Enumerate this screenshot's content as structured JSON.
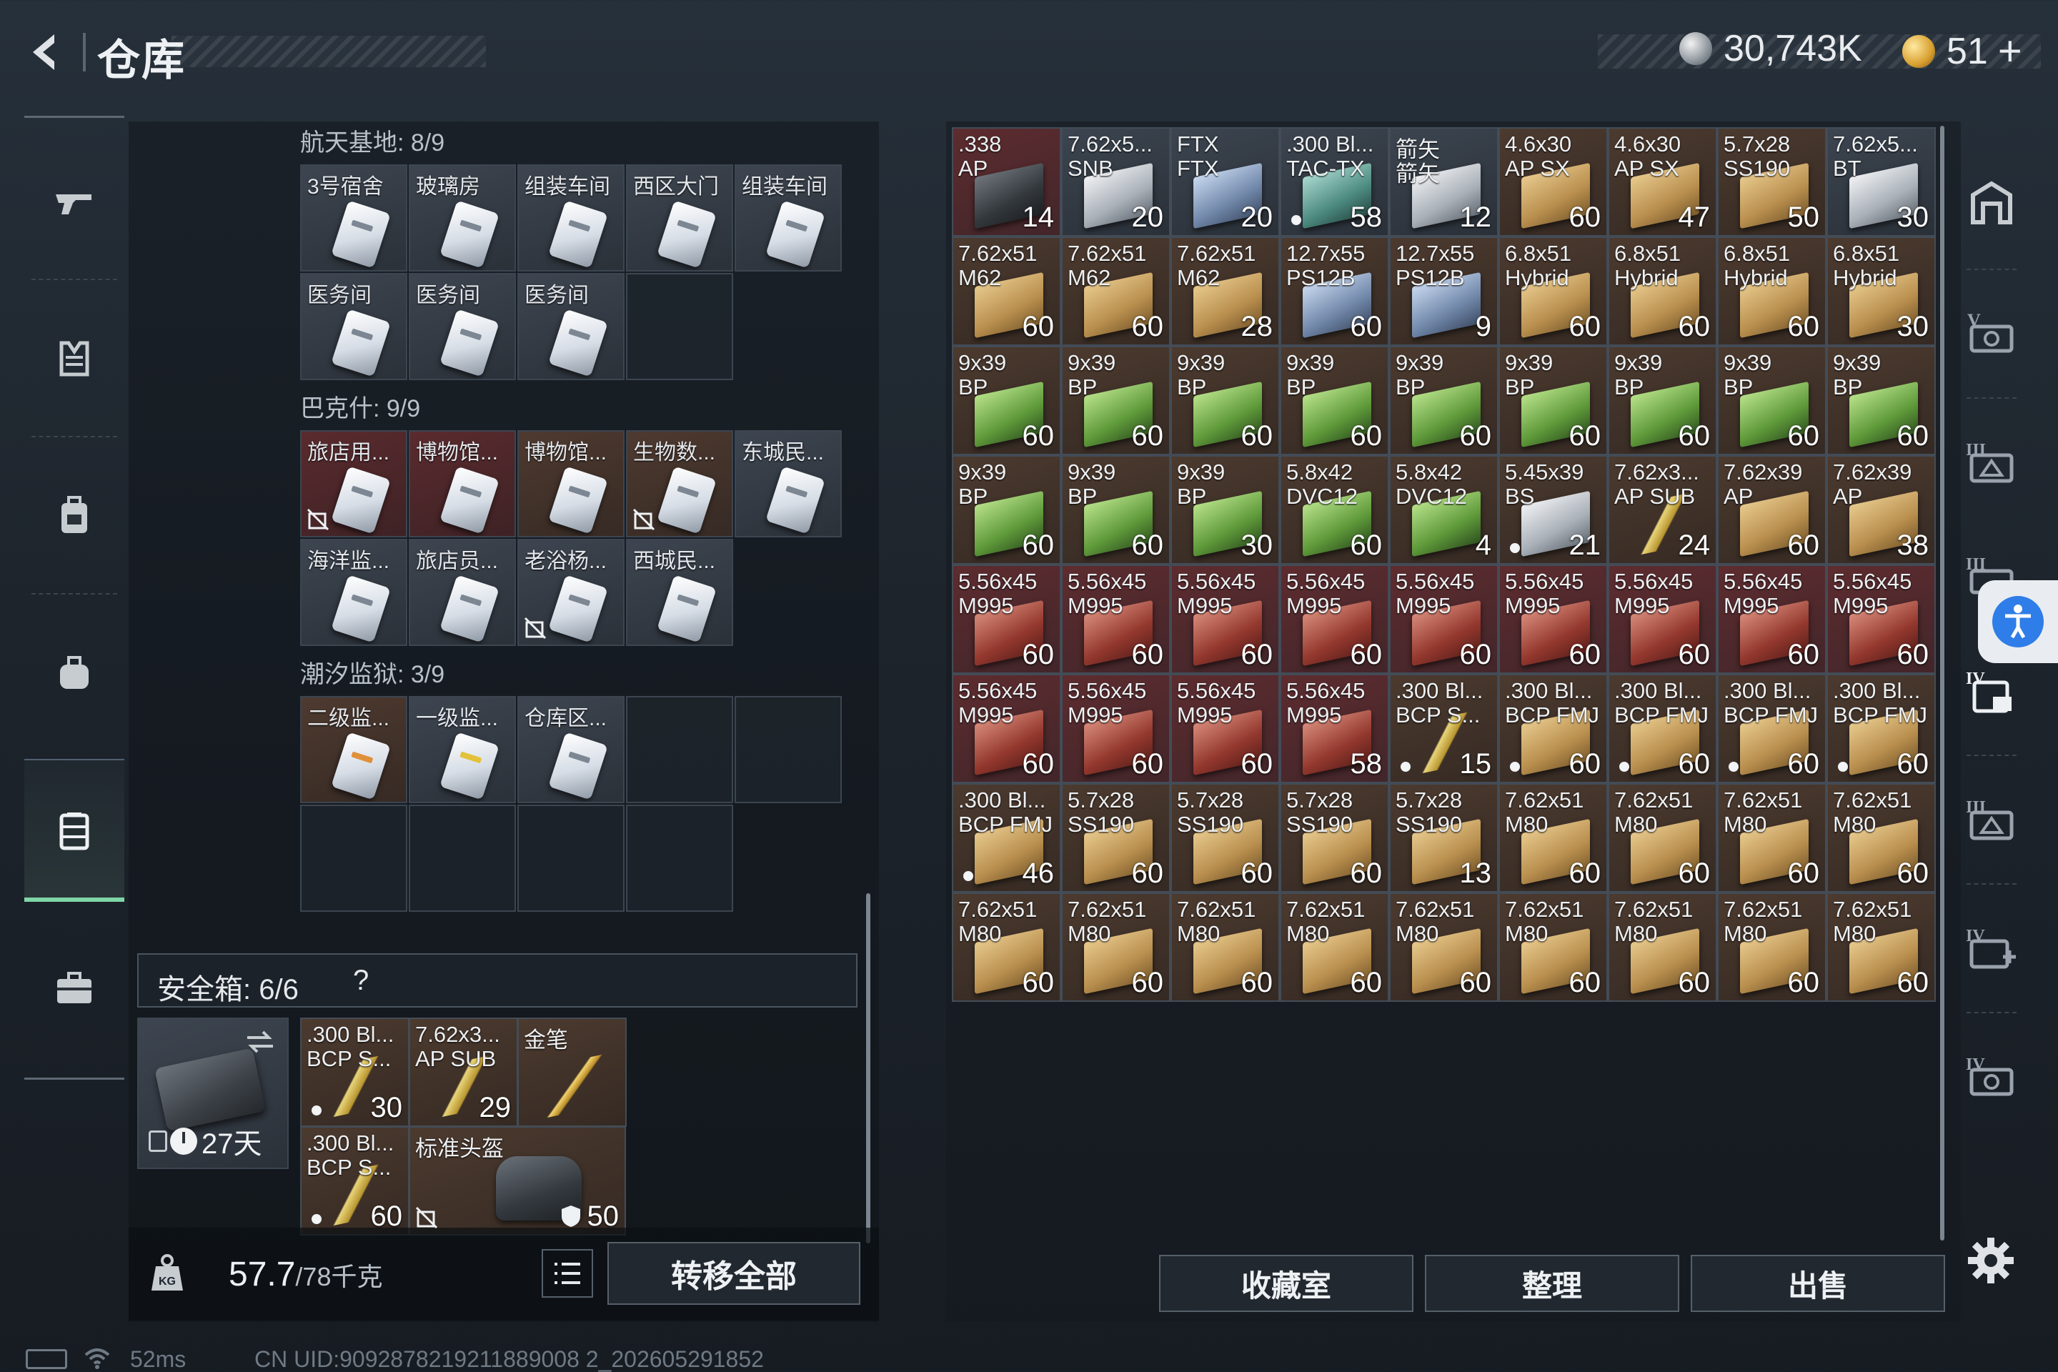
{
  "header": {
    "title": "仓库",
    "currency_silver": "30,743K",
    "currency_gold": "51",
    "plus_label": "+"
  },
  "left_nav": {
    "items": [
      "gun-icon",
      "armor-icon",
      "backpack-icon",
      "bag-icon",
      "stash-icon",
      "briefcase-icon"
    ],
    "active": "stash-icon"
  },
  "key_sections": [
    {
      "label": "航天基地: 8/9",
      "cells": [
        {
          "name": "3号宿舍",
          "bg": "grey"
        },
        {
          "name": "玻璃房",
          "bg": "grey"
        },
        {
          "name": "组装车间",
          "bg": "grey"
        },
        {
          "name": "西区大门",
          "bg": "grey"
        },
        {
          "name": "组装车间",
          "bg": "grey"
        },
        {
          "name": "医务间",
          "bg": "grey"
        },
        {
          "name": "医务间",
          "bg": "grey"
        },
        {
          "name": "医务间",
          "bg": "grey"
        },
        {
          "name": "",
          "bg": "empty"
        }
      ]
    },
    {
      "label": "巴克什: 9/9",
      "cells": [
        {
          "name": "旅店用...",
          "bg": "red",
          "no_trade": true
        },
        {
          "name": "博物馆...",
          "bg": "red"
        },
        {
          "name": "博物馆...",
          "bg": "brown"
        },
        {
          "name": "生物数...",
          "bg": "brown",
          "no_trade": true
        },
        {
          "name": "东城民...",
          "bg": "grey"
        },
        {
          "name": "海洋监...",
          "bg": "grey"
        },
        {
          "name": "旅店员...",
          "bg": "grey"
        },
        {
          "name": "老浴杨...",
          "bg": "grey",
          "no_trade": true
        },
        {
          "name": "西城民...",
          "bg": "grey"
        }
      ]
    },
    {
      "label": "潮汐监狱: 3/9",
      "cells": [
        {
          "name": "二级监...",
          "bg": "brown",
          "card": "orange"
        },
        {
          "name": "一级监...",
          "bg": "grey",
          "card": "yellow"
        },
        {
          "name": "仓库区...",
          "bg": "grey"
        },
        {
          "name": "",
          "bg": "empty"
        },
        {
          "name": "",
          "bg": "empty"
        },
        {
          "name": "",
          "bg": "empty"
        },
        {
          "name": "",
          "bg": "empty"
        },
        {
          "name": "",
          "bg": "empty"
        },
        {
          "name": "",
          "bg": "empty"
        }
      ]
    }
  ],
  "safe_box": {
    "title": "安全箱: 6/6",
    "help": "?",
    "timer": "27天",
    "items": [
      {
        "n1": ".300 Bl...",
        "n2": "BCP S...",
        "count": "30",
        "dot": true,
        "art": "cartridge",
        "bg": "brown"
      },
      {
        "n1": "7.62x3...",
        "n2": "AP SUB",
        "count": "29",
        "art": "cartridge",
        "bg": "brown"
      },
      {
        "n1": "金笔",
        "n2": "",
        "count": "",
        "art": "pen",
        "bg": "brown"
      },
      {
        "n1": ".300 Bl...",
        "n2": "BCP S...",
        "count": "60",
        "dot": true,
        "art": "cartridge",
        "bg": "brown",
        "no_trade": true
      },
      {
        "n1": "标准头盔",
        "n2": "",
        "count": "50",
        "art": "bag",
        "bg": "brown",
        "no_trade": true,
        "shield": true
      }
    ]
  },
  "weight": {
    "current": "57.7",
    "total": "/78千克",
    "transfer_label": "转移全部"
  },
  "stash": {
    "cells": [
      {
        "n1": ".338",
        "n2": "AP",
        "count": "14",
        "bg": "red",
        "art": "dark"
      },
      {
        "n1": "7.62x5...",
        "n2": "SNB",
        "count": "20",
        "bg": "grey",
        "art": "silver"
      },
      {
        "n1": "FTX",
        "n2": "FTX",
        "count": "20",
        "bg": "grey",
        "art": "blue"
      },
      {
        "n1": ".300 Bl...",
        "n2": "TAC-TX",
        "count": "58",
        "bg": "grey",
        "art": "teal",
        "dot": true
      },
      {
        "n1": "箭矢",
        "n2": "箭矢",
        "count": "12",
        "bg": "grey",
        "art": "silver"
      },
      {
        "n1": "4.6x30",
        "n2": "AP SX",
        "count": "60",
        "bg": "brown",
        "art": "box"
      },
      {
        "n1": "4.6x30",
        "n2": "AP SX",
        "count": "47",
        "bg": "brown",
        "art": "box"
      },
      {
        "n1": "5.7x28",
        "n2": "SS190",
        "count": "50",
        "bg": "brown",
        "art": "box"
      },
      {
        "n1": "7.62x5...",
        "n2": "BT",
        "count": "30",
        "bg": "grey",
        "art": "silver"
      },
      {
        "n1": "7.62x51",
        "n2": "M62",
        "count": "60",
        "bg": "brown",
        "art": "box"
      },
      {
        "n1": "7.62x51",
        "n2": "M62",
        "count": "60",
        "bg": "brown",
        "art": "box"
      },
      {
        "n1": "7.62x51",
        "n2": "M62",
        "count": "28",
        "bg": "brown",
        "art": "box"
      },
      {
        "n1": "12.7x55",
        "n2": "PS12B",
        "count": "60",
        "bg": "brown",
        "art": "blue"
      },
      {
        "n1": "12.7x55",
        "n2": "PS12B",
        "count": "9",
        "bg": "brown",
        "art": "blue"
      },
      {
        "n1": "6.8x51",
        "n2": "Hybrid",
        "count": "60",
        "bg": "brown",
        "art": "box"
      },
      {
        "n1": "6.8x51",
        "n2": "Hybrid",
        "count": "60",
        "bg": "brown",
        "art": "box"
      },
      {
        "n1": "6.8x51",
        "n2": "Hybrid",
        "count": "60",
        "bg": "brown",
        "art": "box"
      },
      {
        "n1": "6.8x51",
        "n2": "Hybrid",
        "count": "30",
        "bg": "brown",
        "art": "box"
      },
      {
        "n1": "9x39",
        "n2": "BP",
        "count": "60",
        "bg": "brown",
        "art": "green"
      },
      {
        "n1": "9x39",
        "n2": "BP",
        "count": "60",
        "bg": "brown",
        "art": "green"
      },
      {
        "n1": "9x39",
        "n2": "BP",
        "count": "60",
        "bg": "brown",
        "art": "green"
      },
      {
        "n1": "9x39",
        "n2": "BP",
        "count": "60",
        "bg": "brown",
        "art": "green"
      },
      {
        "n1": "9x39",
        "n2": "BP",
        "count": "60",
        "bg": "brown",
        "art": "green"
      },
      {
        "n1": "9x39",
        "n2": "BP",
        "count": "60",
        "bg": "brown",
        "art": "green"
      },
      {
        "n1": "9x39",
        "n2": "BP",
        "count": "60",
        "bg": "brown",
        "art": "green"
      },
      {
        "n1": "9x39",
        "n2": "BP",
        "count": "60",
        "bg": "brown",
        "art": "green"
      },
      {
        "n1": "9x39",
        "n2": "BP",
        "count": "60",
        "bg": "brown",
        "art": "green"
      },
      {
        "n1": "9x39",
        "n2": "BP",
        "count": "60",
        "bg": "brown",
        "art": "green"
      },
      {
        "n1": "9x39",
        "n2": "BP",
        "count": "60",
        "bg": "brown",
        "art": "green"
      },
      {
        "n1": "9x39",
        "n2": "BP",
        "count": "30",
        "bg": "brown",
        "art": "green"
      },
      {
        "n1": "5.8x42",
        "n2": "DVC12",
        "count": "60",
        "bg": "brown",
        "art": "green"
      },
      {
        "n1": "5.8x42",
        "n2": "DVC12",
        "count": "4",
        "bg": "brown",
        "art": "green"
      },
      {
        "n1": "5.45x39",
        "n2": "BS",
        "count": "21",
        "bg": "brown",
        "art": "silver",
        "dot": true
      },
      {
        "n1": "7.62x3...",
        "n2": "AP SUB",
        "count": "24",
        "bg": "brown",
        "art": "cartridge"
      },
      {
        "n1": "7.62x39",
        "n2": "AP",
        "count": "60",
        "bg": "brown",
        "art": "box"
      },
      {
        "n1": "7.62x39",
        "n2": "AP",
        "count": "38",
        "bg": "brown",
        "art": "box"
      },
      {
        "n1": "5.56x45",
        "n2": "M995",
        "count": "60",
        "bg": "red",
        "art": "red"
      },
      {
        "n1": "5.56x45",
        "n2": "M995",
        "count": "60",
        "bg": "red",
        "art": "red"
      },
      {
        "n1": "5.56x45",
        "n2": "M995",
        "count": "60",
        "bg": "red",
        "art": "red"
      },
      {
        "n1": "5.56x45",
        "n2": "M995",
        "count": "60",
        "bg": "red",
        "art": "red"
      },
      {
        "n1": "5.56x45",
        "n2": "M995",
        "count": "60",
        "bg": "red",
        "art": "red"
      },
      {
        "n1": "5.56x45",
        "n2": "M995",
        "count": "60",
        "bg": "red",
        "art": "red"
      },
      {
        "n1": "5.56x45",
        "n2": "M995",
        "count": "60",
        "bg": "red",
        "art": "red"
      },
      {
        "n1": "5.56x45",
        "n2": "M995",
        "count": "60",
        "bg": "red",
        "art": "red"
      },
      {
        "n1": "5.56x45",
        "n2": "M995",
        "count": "60",
        "bg": "red",
        "art": "red"
      },
      {
        "n1": "5.56x45",
        "n2": "M995",
        "count": "60",
        "bg": "red",
        "art": "red"
      },
      {
        "n1": "5.56x45",
        "n2": "M995",
        "count": "60",
        "bg": "red",
        "art": "red"
      },
      {
        "n1": "5.56x45",
        "n2": "M995",
        "count": "60",
        "bg": "red",
        "art": "red"
      },
      {
        "n1": "5.56x45",
        "n2": "M995",
        "count": "58",
        "bg": "red",
        "art": "red"
      },
      {
        "n1": ".300 Bl...",
        "n2": "BCP S...",
        "count": "15",
        "bg": "brown",
        "art": "cartridge",
        "dot": true
      },
      {
        "n1": ".300 Bl...",
        "n2": "BCP FMJ",
        "count": "60",
        "bg": "brown",
        "art": "box",
        "dot": true
      },
      {
        "n1": ".300 Bl...",
        "n2": "BCP FMJ",
        "count": "60",
        "bg": "brown",
        "art": "box",
        "dot": true
      },
      {
        "n1": ".300 Bl...",
        "n2": "BCP FMJ",
        "count": "60",
        "bg": "brown",
        "art": "box",
        "dot": true
      },
      {
        "n1": ".300 Bl...",
        "n2": "BCP FMJ",
        "count": "60",
        "bg": "brown",
        "art": "box",
        "dot": true
      },
      {
        "n1": ".300 Bl...",
        "n2": "BCP FMJ",
        "count": "46",
        "bg": "brown",
        "art": "box",
        "dot": true
      },
      {
        "n1": "5.7x28",
        "n2": "SS190",
        "count": "60",
        "bg": "brown",
        "art": "box"
      },
      {
        "n1": "5.7x28",
        "n2": "SS190",
        "count": "60",
        "bg": "brown",
        "art": "box"
      },
      {
        "n1": "5.7x28",
        "n2": "SS190",
        "count": "60",
        "bg": "brown",
        "art": "box"
      },
      {
        "n1": "5.7x28",
        "n2": "SS190",
        "count": "13",
        "bg": "brown",
        "art": "box"
      },
      {
        "n1": "7.62x51",
        "n2": "M80",
        "count": "60",
        "bg": "brown",
        "art": "box"
      },
      {
        "n1": "7.62x51",
        "n2": "M80",
        "count": "60",
        "bg": "brown",
        "art": "box"
      },
      {
        "n1": "7.62x51",
        "n2": "M80",
        "count": "60",
        "bg": "brown",
        "art": "box"
      },
      {
        "n1": "7.62x51",
        "n2": "M80",
        "count": "60",
        "bg": "brown",
        "art": "box"
      },
      {
        "n1": "7.62x51",
        "n2": "M80",
        "count": "60",
        "bg": "brown",
        "art": "box"
      },
      {
        "n1": "7.62x51",
        "n2": "M80",
        "count": "60",
        "bg": "brown",
        "art": "box"
      },
      {
        "n1": "7.62x51",
        "n2": "M80",
        "count": "60",
        "bg": "brown",
        "art": "box"
      },
      {
        "n1": "7.62x51",
        "n2": "M80",
        "count": "60",
        "bg": "brown",
        "art": "box"
      },
      {
        "n1": "7.62x51",
        "n2": "M80",
        "count": "60",
        "bg": "brown",
        "art": "box"
      },
      {
        "n1": "7.62x51",
        "n2": "M80",
        "count": "60",
        "bg": "brown",
        "art": "box"
      },
      {
        "n1": "7.62x51",
        "n2": "M80",
        "count": "60",
        "bg": "brown",
        "art": "box"
      },
      {
        "n1": "7.62x51",
        "n2": "M80",
        "count": "60",
        "bg": "brown",
        "art": "box"
      },
      {
        "n1": "7.62x51",
        "n2": "M80",
        "count": "60",
        "bg": "brown",
        "art": "box"
      }
    ]
  },
  "right_nav": {
    "items": [
      "stash-tab-icon",
      "tier-v-icon",
      "tier-iii-icon",
      "tier-iii-icon",
      "tier-iv-icon",
      "tier-iii-icon",
      "tier-iv-add-icon",
      "tier-iv-icon"
    ]
  },
  "bottom_buttons": {
    "collection": "收藏室",
    "organize": "整理",
    "sell": "出售"
  },
  "status": {
    "ping": "52ms",
    "uid": "CN UID:9092878219211889008 2_202605291852"
  },
  "colors": {
    "accent_green": "#7fd6a7",
    "access_blue": "#2f7de8"
  }
}
